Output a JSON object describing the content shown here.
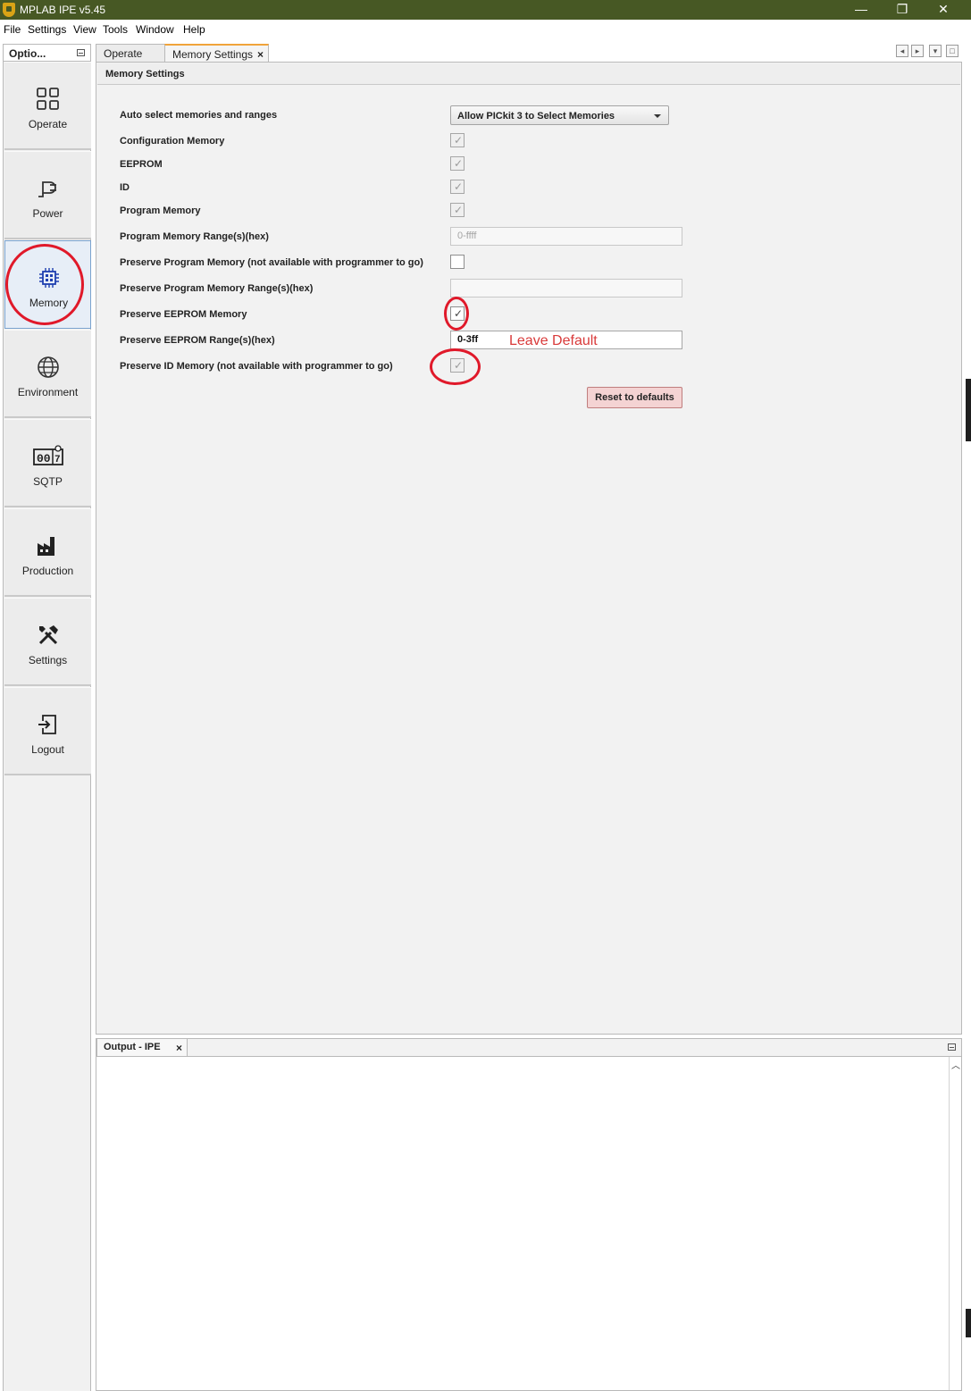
{
  "window": {
    "title": "MPLAB IPE v5.45",
    "controls": {
      "minimize": "—",
      "maximize": "❐",
      "close": "✕"
    }
  },
  "menu": [
    "File",
    "Settings",
    "View",
    "Tools",
    "Window",
    "Help"
  ],
  "sidebar": {
    "header": "Optio...",
    "items": [
      {
        "label": "Operate",
        "icon": "operate-grid-icon"
      },
      {
        "label": "Power",
        "icon": "power-plug-icon"
      },
      {
        "label": "Memory",
        "icon": "memory-chip-icon",
        "active": true
      },
      {
        "label": "Environment",
        "icon": "globe-icon"
      },
      {
        "label": "SQTP",
        "icon": "counter-icon"
      },
      {
        "label": "Production",
        "icon": "factory-icon"
      },
      {
        "label": "Settings",
        "icon": "tools-icon"
      },
      {
        "label": "Logout",
        "icon": "logout-icon"
      }
    ]
  },
  "tabs": {
    "items": [
      {
        "label": "Operate"
      },
      {
        "label": "Memory Settings",
        "active": true,
        "close": "×"
      }
    ]
  },
  "memory_settings": {
    "header": "Memory Settings",
    "auto_select": {
      "label": "Auto select memories and ranges",
      "value": "Allow PICkit 3 to Select Memories"
    },
    "config_memory": {
      "label": "Configuration Memory",
      "checked": true,
      "enabled": false
    },
    "eeprom": {
      "label": "EEPROM",
      "checked": true,
      "enabled": false
    },
    "id": {
      "label": "ID",
      "checked": true,
      "enabled": false
    },
    "program_memory": {
      "label": "Program Memory",
      "checked": true,
      "enabled": false
    },
    "program_range": {
      "label": "Program Memory Range(s)(hex)",
      "value": "0-ffff"
    },
    "preserve_program": {
      "label": "Preserve Program Memory (not available with programmer to go)",
      "checked": false
    },
    "preserve_program_range": {
      "label": "Preserve Program Memory Range(s)(hex)",
      "value": ""
    },
    "preserve_eeprom": {
      "label": "Preserve EEPROM Memory",
      "checked": true
    },
    "preserve_eeprom_range": {
      "label": "Preserve EEPROM Range(s)(hex)",
      "value": "0-3ff"
    },
    "preserve_id": {
      "label": "Preserve ID Memory (not available with programmer to go)",
      "checked": true
    },
    "annotation": "Leave Default",
    "reset_button": "Reset to defaults"
  },
  "output": {
    "tab_label": "Output - IPE",
    "close": "×",
    "content": ""
  },
  "colors": {
    "titlebar": "#475824",
    "annotation_red": "#e0192a",
    "reset_button_bg": "#f4d3d3",
    "active_tab_accent": "#f0a33a"
  }
}
